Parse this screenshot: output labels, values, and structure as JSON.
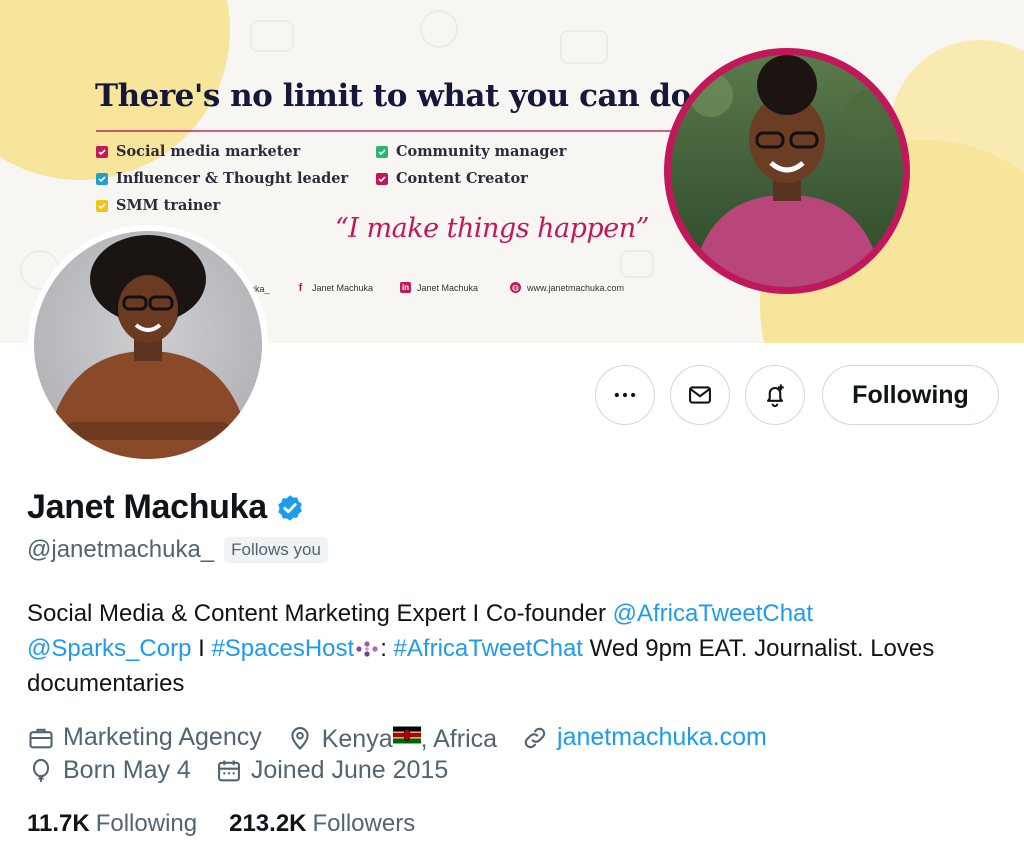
{
  "banner": {
    "headline": "There's no limit to what you can do.",
    "roles": [
      {
        "label": "Social media marketer",
        "color": "#c2185b"
      },
      {
        "label": "Influencer & Thought leader",
        "color": "#1fa2c9"
      },
      {
        "label": "SMM trainer",
        "color": "#f0c419"
      },
      {
        "label": "Community manager",
        "color": "#2bb673"
      },
      {
        "label": "Content Creator",
        "color": "#c2185b"
      }
    ],
    "quote": "“I make things happen”",
    "socials": [
      {
        "icon": "twitter-icon",
        "label": "uka_"
      },
      {
        "icon": "facebook-icon",
        "label": "Janet Machuka"
      },
      {
        "icon": "linkedin-icon",
        "label": "Janet Machuka"
      },
      {
        "icon": "globe-icon",
        "label": "www.janetmachuka.com"
      }
    ]
  },
  "actions": {
    "more_icon": "more-horizontal-icon",
    "message_icon": "envelope-icon",
    "notify_icon": "bell-plus-icon",
    "follow_label": "Following"
  },
  "profile": {
    "name": "Janet Machuka",
    "verified": true,
    "handle": "@janetmachuka_",
    "follows_you": "Follows you",
    "bio": {
      "t1": "Social Media & Content Marketing Expert I Co-founder ",
      "l1": "@AfricaTweetChat",
      "l2": "@Sparks_Corp",
      "t2": " I ",
      "l3": "#SpacesHost",
      "t3": ": ",
      "l4": "#AfricaTweetChat",
      "t4": " Wed 9pm EAT. Journalist. Loves documentaries"
    },
    "category": "Marketing Agency",
    "location_country": "Kenya",
    "location_region": ", Africa",
    "website": "janetmachuka.com",
    "birthday": "Born May 4",
    "joined": "Joined June 2015"
  },
  "stats": {
    "following_count": "11.7K",
    "following_label": "Following",
    "followers_count": "213.2K",
    "followers_label": "Followers"
  },
  "colors": {
    "accent": "#1d9bf0",
    "banner_magenta": "#c2185b",
    "banner_yellow": "#f6e59a"
  }
}
